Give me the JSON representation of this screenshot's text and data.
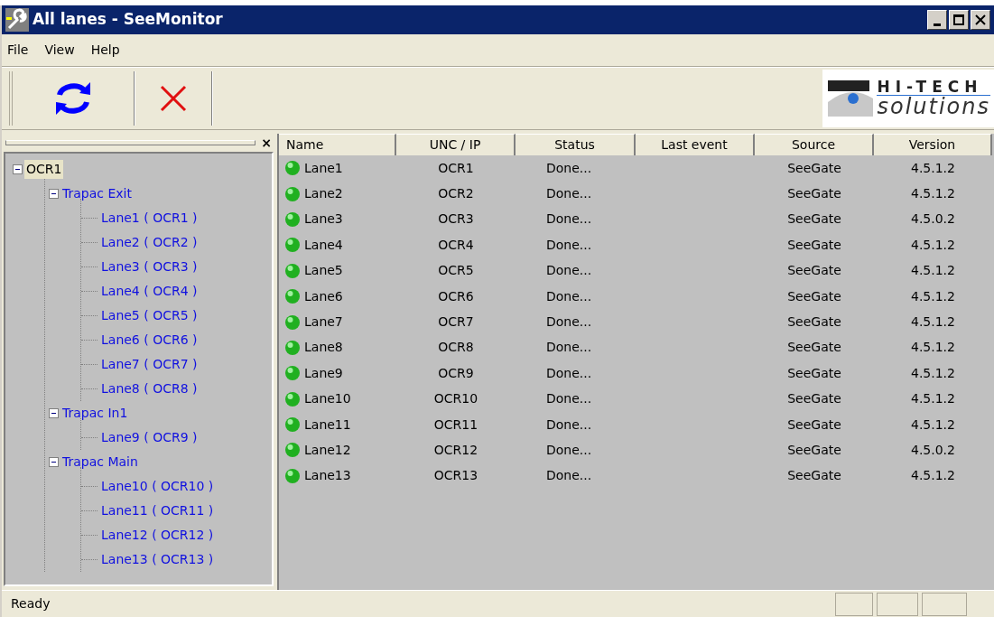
{
  "window": {
    "title": "All lanes - SeeMonitor"
  },
  "menu": [
    "File",
    "View",
    "Help"
  ],
  "logo": {
    "line1": "HI-TECH",
    "line2": "solutions"
  },
  "panel_close": "×",
  "tree": [
    {
      "label": "OCR1",
      "selected": true,
      "expanded": true,
      "children": [
        {
          "label": "Trapac Exit",
          "selected": false,
          "expanded": true,
          "children": [
            {
              "label": "Lane1 ( OCR1 )",
              "selected": false
            },
            {
              "label": "Lane2 ( OCR2 )",
              "selected": false
            },
            {
              "label": "Lane3 ( OCR3 )",
              "selected": false
            },
            {
              "label": "Lane4 ( OCR4 )",
              "selected": false
            },
            {
              "label": "Lane5 ( OCR5 )",
              "selected": false
            },
            {
              "label": "Lane6 ( OCR6 )",
              "selected": false
            },
            {
              "label": "Lane7 ( OCR7 )",
              "selected": false
            },
            {
              "label": "Lane8 ( OCR8 )",
              "selected": false
            }
          ]
        },
        {
          "label": "Trapac In1",
          "selected": false,
          "expanded": true,
          "children": [
            {
              "label": "Lane9 ( OCR9 )",
              "selected": false
            }
          ]
        },
        {
          "label": "Trapac Main",
          "selected": false,
          "expanded": true,
          "children": [
            {
              "label": "Lane10 ( OCR10 )",
              "selected": false
            },
            {
              "label": "Lane11 ( OCR11 )",
              "selected": false
            },
            {
              "label": "Lane12 ( OCR12 )",
              "selected": false
            },
            {
              "label": "Lane13 ( OCR13 )",
              "selected": false
            }
          ]
        }
      ]
    }
  ],
  "table": {
    "columns": [
      "Name",
      "UNC / IP",
      "Status",
      "Last event",
      "Source",
      "Version"
    ],
    "rows": [
      [
        "Lane1",
        "OCR1",
        "Done...",
        "",
        "SeeGate",
        "4.5.1.2"
      ],
      [
        "Lane2",
        "OCR2",
        "Done...",
        "",
        "SeeGate",
        "4.5.1.2"
      ],
      [
        "Lane3",
        "OCR3",
        "Done...",
        "",
        "SeeGate",
        "4.5.0.2"
      ],
      [
        "Lane4",
        "OCR4",
        "Done...",
        "",
        "SeeGate",
        "4.5.1.2"
      ],
      [
        "Lane5",
        "OCR5",
        "Done...",
        "",
        "SeeGate",
        "4.5.1.2"
      ],
      [
        "Lane6",
        "OCR6",
        "Done...",
        "",
        "SeeGate",
        "4.5.1.2"
      ],
      [
        "Lane7",
        "OCR7",
        "Done...",
        "",
        "SeeGate",
        "4.5.1.2"
      ],
      [
        "Lane8",
        "OCR8",
        "Done...",
        "",
        "SeeGate",
        "4.5.1.2"
      ],
      [
        "Lane9",
        "OCR9",
        "Done...",
        "",
        "SeeGate",
        "4.5.1.2"
      ],
      [
        "Lane10",
        "OCR10",
        "Done...",
        "",
        "SeeGate",
        "4.5.1.2"
      ],
      [
        "Lane11",
        "OCR11",
        "Done...",
        "",
        "SeeGate",
        "4.5.1.2"
      ],
      [
        "Lane12",
        "OCR12",
        "Done...",
        "",
        "SeeGate",
        "4.5.0.2"
      ],
      [
        "Lane13",
        "OCR13",
        "Done...",
        "",
        "SeeGate",
        "4.5.1.2"
      ]
    ]
  },
  "status_bar": {
    "text": "Ready"
  }
}
